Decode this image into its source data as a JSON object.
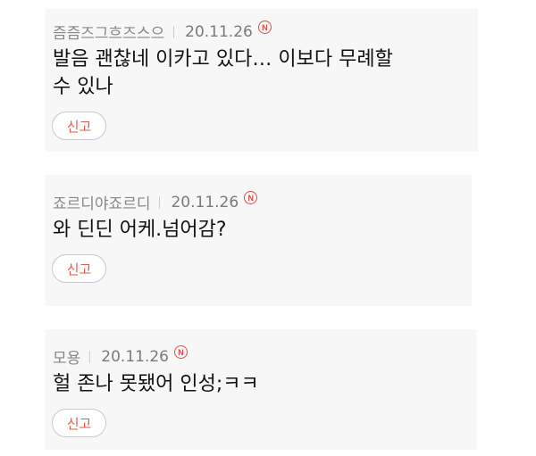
{
  "comments": [
    {
      "author": "즘즘즈그흐즈스으",
      "date": "20.11.26",
      "badge": "N",
      "text": "발음 괜찮네 이카고 있다… 이보다 무례할\n수 있나",
      "report_label": "신고"
    },
    {
      "author": "죠르디야죠르디",
      "date": "20.11.26",
      "badge": "N",
      "text": "와 딘딘 어케.넘어감?",
      "report_label": "신고"
    },
    {
      "author": "모용",
      "date": "20.11.26",
      "badge": "N",
      "text": "헐 존나 못됐어 인성;ㅋㅋ",
      "report_label": "신고"
    }
  ],
  "colors": {
    "card_bg": "#f7f7f7",
    "report_text": "#e25a4a",
    "new_badge": "#e24a4a"
  }
}
